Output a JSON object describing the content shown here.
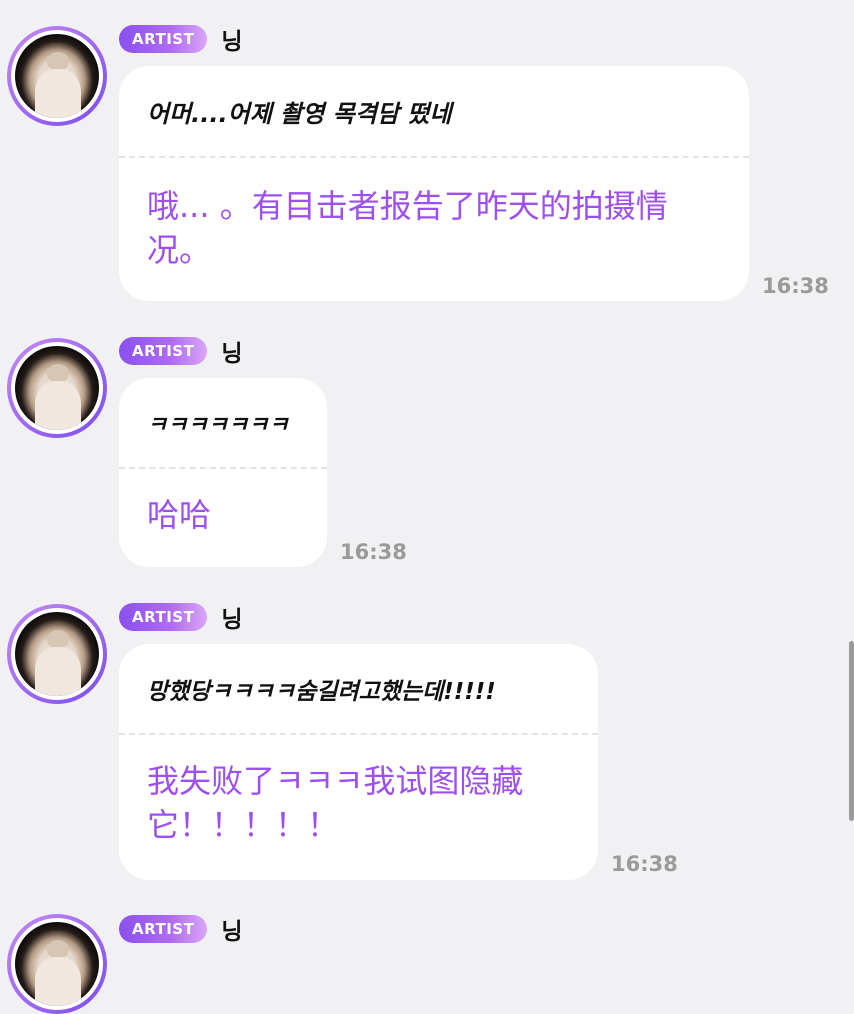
{
  "messages": [
    {
      "badge": "ARTIST",
      "name": "닝",
      "original": "어머....어제 촬영 목격담 떴네",
      "translation": "哦... 。有目击者报告了昨天的拍摄情况。",
      "time": "16:38"
    },
    {
      "badge": "ARTIST",
      "name": "닝",
      "original": "ㅋㅋㅋㅋㅋㅋㅋ",
      "translation": "哈哈",
      "time": "16:38"
    },
    {
      "badge": "ARTIST",
      "name": "닝",
      "original": "망했당ㅋㅋㅋㅋ숨길려고했는데!!!!!",
      "translation": "我失败了ㅋㅋㅋ我试图隐藏它！！！！！",
      "time": "16:38"
    },
    {
      "badge": "ARTIST",
      "name": "닝"
    }
  ],
  "colors": {
    "background": "#f1f1f3",
    "translation_text": "#9d4ff0",
    "badge_start": "#8a4ff0",
    "badge_end": "#d9a6f6",
    "timestamp": "#9a9a9a"
  }
}
